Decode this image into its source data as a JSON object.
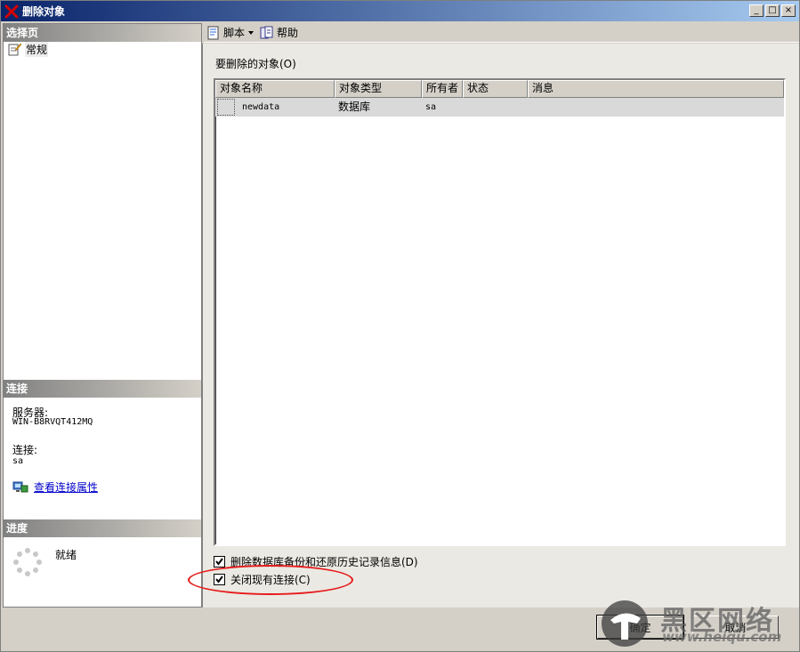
{
  "window": {
    "title": "删除对象",
    "minimize_glyph": "_",
    "maximize_glyph": "□",
    "close_glyph": "×"
  },
  "left_panel": {
    "pages_header": "选择页",
    "pages": [
      {
        "label": "常规",
        "icon": "general-page-icon"
      }
    ],
    "connection_header": "连接",
    "server_label": "服务器:",
    "server_value": "WIN-B8RVQT412MQ",
    "connection_label": "连接:",
    "connection_value": "sa",
    "view_connection_link": "查看连接属性",
    "progress_header": "进度",
    "progress_status": "就绪"
  },
  "toolbar": {
    "script_label": "脚本",
    "help_label": "帮助"
  },
  "main": {
    "objects_label": "要删除的对象(O)",
    "columns": [
      "对象名称",
      "对象类型",
      "所有者",
      "状态",
      "消息"
    ],
    "rows": [
      {
        "name": "newdata",
        "type": "数据库",
        "owner": "sa",
        "status": "",
        "message": ""
      }
    ],
    "options": [
      {
        "label": "删除数据库备份和还原历史记录信息(D)",
        "checked": true
      },
      {
        "label": "关闭现有连接(C)",
        "checked": true
      }
    ]
  },
  "buttons": {
    "ok": "确定",
    "cancel": "取消"
  },
  "watermark": {
    "text": "黑区网络",
    "url": "www.heiqu.com"
  },
  "colors": {
    "highlight_ellipse": "#e51b1b",
    "link": "#0000cc",
    "title_gradient_start": "#0a246a"
  }
}
